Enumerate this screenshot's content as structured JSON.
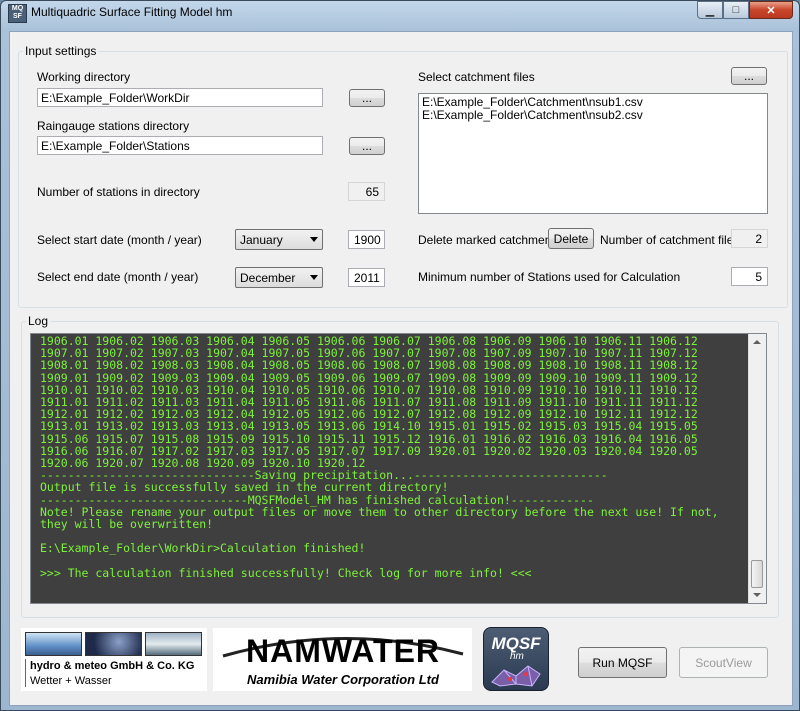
{
  "window": {
    "title": "Multiquadric Surface Fitting Model hm",
    "icon_text": "MQ SF"
  },
  "input_settings": {
    "legend": "Input settings",
    "working_directory": {
      "label": "Working directory",
      "value": "E:\\Example_Folder\\WorkDir",
      "browse_label": "..."
    },
    "raingauge_directory": {
      "label": "Raingauge stations directory",
      "value": "E:\\Example_Folder\\Stations",
      "browse_label": "..."
    },
    "stations_count": {
      "label": "Number of stations in directory",
      "value": "65"
    },
    "start_date": {
      "label": "Select start date (month / year)",
      "month": "January",
      "year": "1900"
    },
    "end_date": {
      "label": "Select end date (month / year)",
      "month": "December",
      "year": "2011"
    },
    "catchment_files": {
      "label": "Select catchment files",
      "browse_label": "...",
      "items": [
        "E:\\Example_Folder\\Catchment\\nsub1.csv",
        "E:\\Example_Folder\\Catchment\\nsub2.csv"
      ]
    },
    "delete_marked": {
      "label": "Delete marked catchments",
      "button": "Delete"
    },
    "catchment_count": {
      "label": "Number of catchment files",
      "value": "2"
    },
    "min_stations": {
      "label": "Minimum number of Stations used for Calculation",
      "value": "5"
    }
  },
  "log": {
    "legend": "Log",
    "lines": [
      "1906.01 1906.02 1906.03 1906.04 1906.05 1906.06 1906.07 1906.08 1906.09 1906.10 1906.11 1906.12",
      "1907.01 1907.02 1907.03 1907.04 1907.05 1907.06 1907.07 1907.08 1907.09 1907.10 1907.11 1907.12",
      "1908.01 1908.02 1908.03 1908.04 1908.05 1908.06 1908.07 1908.08 1908.09 1908.10 1908.11 1908.12",
      "1909.01 1909.02 1909.03 1909.04 1909.05 1909.06 1909.07 1909.08 1909.09 1909.10 1909.11 1909.12",
      "1910.01 1910.02 1910.03 1910.04 1910.05 1910.06 1910.07 1910.08 1910.09 1910.10 1910.11 1910.12",
      "1911.01 1911.02 1911.03 1911.04 1911.05 1911.06 1911.07 1911.08 1911.09 1911.10 1911.11 1911.12",
      "1912.01 1912.02 1912.03 1912.04 1912.05 1912.06 1912.07 1912.08 1912.09 1912.10 1912.11 1912.12",
      "1913.01 1913.02 1913.03 1913.04 1913.05 1913.06 1914.10 1915.01 1915.02 1915.03 1915.04 1915.05",
      "1915.06 1915.07 1915.08 1915.09 1915.10 1915.11 1915.12 1916.01 1916.02 1916.03 1916.04 1916.05",
      "1916.06 1916.07 1917.02 1917.03 1917.05 1917.07 1917.09 1920.01 1920.02 1920.03 1920.04 1920.05",
      "1920.06 1920.07 1920.08 1920.09 1920.10 1920.12",
      "-------------------------------Saving precipitation...----------------------------",
      "Output file is successfully saved in the current directory!",
      "------------------------------MQSFModel_HM has finished calculation!------------",
      "Note! Please rename your output files or move them to other directory before the next use! If not,",
      "they will be overwritten!",
      "",
      "E:\\Example_Folder\\WorkDir>Calculation finished!",
      "",
      ">>> The calculation finished successfully! Check log for more info! <<<"
    ]
  },
  "logos": {
    "hydromet": {
      "line1": "hydro & meteo GmbH & Co. KG",
      "line2": "Wetter + Wasser"
    },
    "namwater": {
      "name": "NAMWATER",
      "subtitle": "Namibia Water Corporation Ltd"
    },
    "mqsf": {
      "text": "MQSF",
      "sub": "hm"
    }
  },
  "buttons": {
    "run": "Run MQSF",
    "scout": "ScoutView"
  },
  "colors": {
    "log_background": "#3f3f3f",
    "log_text": "#7df23a",
    "close_button": "#c8442a"
  }
}
